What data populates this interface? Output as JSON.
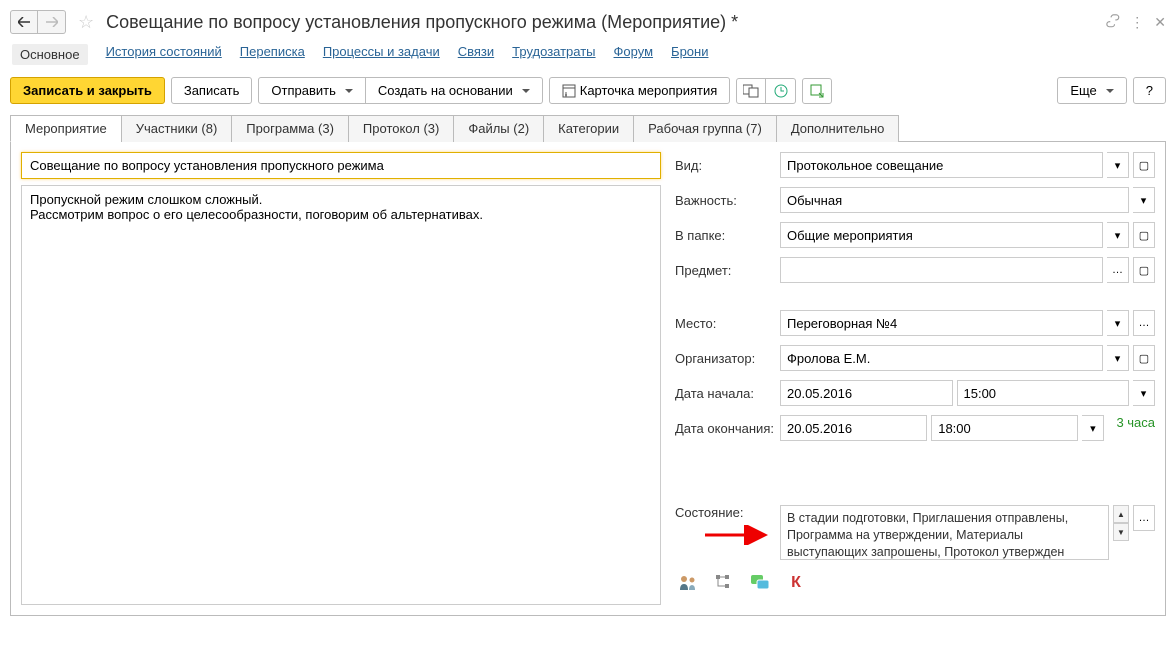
{
  "title": "Совещание по вопросу установления пропускного режима (Мероприятие) *",
  "sectionTabs": {
    "active": "Основное",
    "items": [
      "История состояний",
      "Переписка",
      "Процессы и задачи",
      "Связи",
      "Трудозатраты",
      "Форум",
      "Брони"
    ]
  },
  "toolbar": {
    "saveClose": "Записать и закрыть",
    "save": "Записать",
    "send": "Отправить",
    "createBased": "Создать на основании",
    "card": "Карточка мероприятия",
    "more": "Еще",
    "help": "?"
  },
  "contentTabs": [
    {
      "label": "Мероприятие",
      "active": true
    },
    {
      "label": "Участники (8)"
    },
    {
      "label": "Программа (3)"
    },
    {
      "label": "Протокол (3)"
    },
    {
      "label": "Файлы (2)"
    },
    {
      "label": "Категории"
    },
    {
      "label": "Рабочая группа (7)"
    },
    {
      "label": "Дополнительно"
    }
  ],
  "subject": "Совещание по вопросу установления пропускного режима",
  "description": "Пропускной режим слошком сложный.\nРассмотрим вопрос о его целесообразности, поговорим об альтернативах.",
  "form": {
    "kindLabel": "Вид:",
    "kindValue": "Протокольное совещание",
    "importanceLabel": "Важность:",
    "importanceValue": "Обычная",
    "folderLabel": "В папке:",
    "folderValue": "Общие мероприятия",
    "itemLabel": "Предмет:",
    "itemValue": "",
    "placeLabel": "Место:",
    "placeValue": "Переговорная №4",
    "organizerLabel": "Организатор:",
    "organizerValue": "Фролова Е.М.",
    "dateStartLabel": "Дата начала:",
    "dateStartValue": "20.05.2016",
    "timeStartValue": "15:00",
    "dateEndLabel": "Дата окончания:",
    "dateEndValue": "20.05.2016",
    "timeEndValue": "18:00",
    "duration": "3 часа",
    "stateLabel": "Состояние:",
    "stateValue": "В стадии подготовки, Приглашения отправлены, Программа на утверждении, Материалы выступающих запрошены, Протокол утвержден"
  },
  "iconK": "К"
}
